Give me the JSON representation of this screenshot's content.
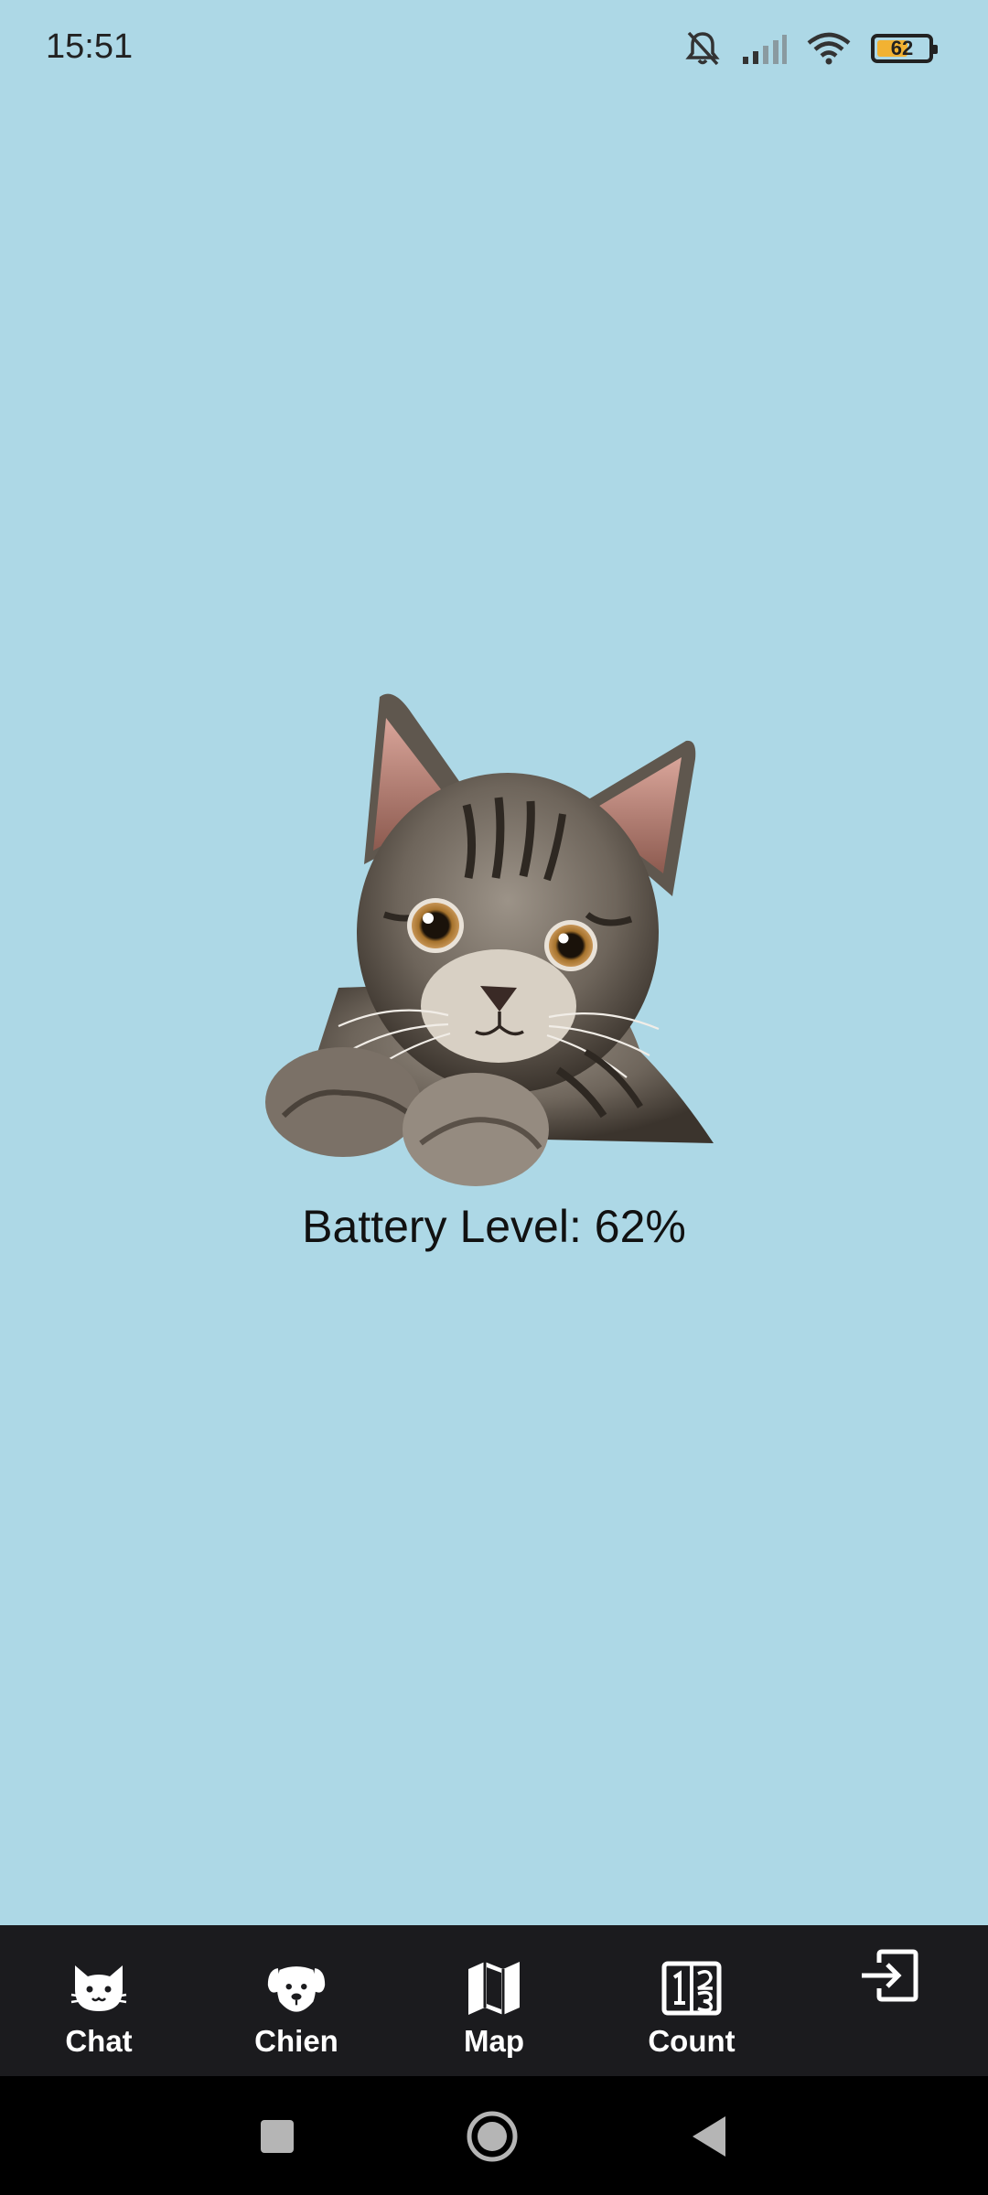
{
  "status_bar": {
    "time": "15:51",
    "icons": [
      "bell-off-icon",
      "signal-icon",
      "wifi-icon",
      "battery-icon"
    ],
    "battery_text": "62",
    "battery_level_fraction": 0.62,
    "battery_fill_color": "#F2B233"
  },
  "main": {
    "image": "cat-photo",
    "battery_label": "Battery Level: 62%"
  },
  "bottom_nav": {
    "background": "#1B1B1E",
    "items": [
      {
        "label": "Chat",
        "icon": "cat-icon"
      },
      {
        "label": "Chien",
        "icon": "dog-icon"
      },
      {
        "label": "Map",
        "icon": "map-icon"
      },
      {
        "label": "Count",
        "icon": "counter-icon"
      },
      {
        "label": "",
        "icon": "logout-icon"
      }
    ]
  },
  "system_nav": {
    "buttons": [
      "recents-icon",
      "home-icon",
      "back-icon"
    ]
  },
  "colors": {
    "page_background": "#ADD8E6"
  }
}
